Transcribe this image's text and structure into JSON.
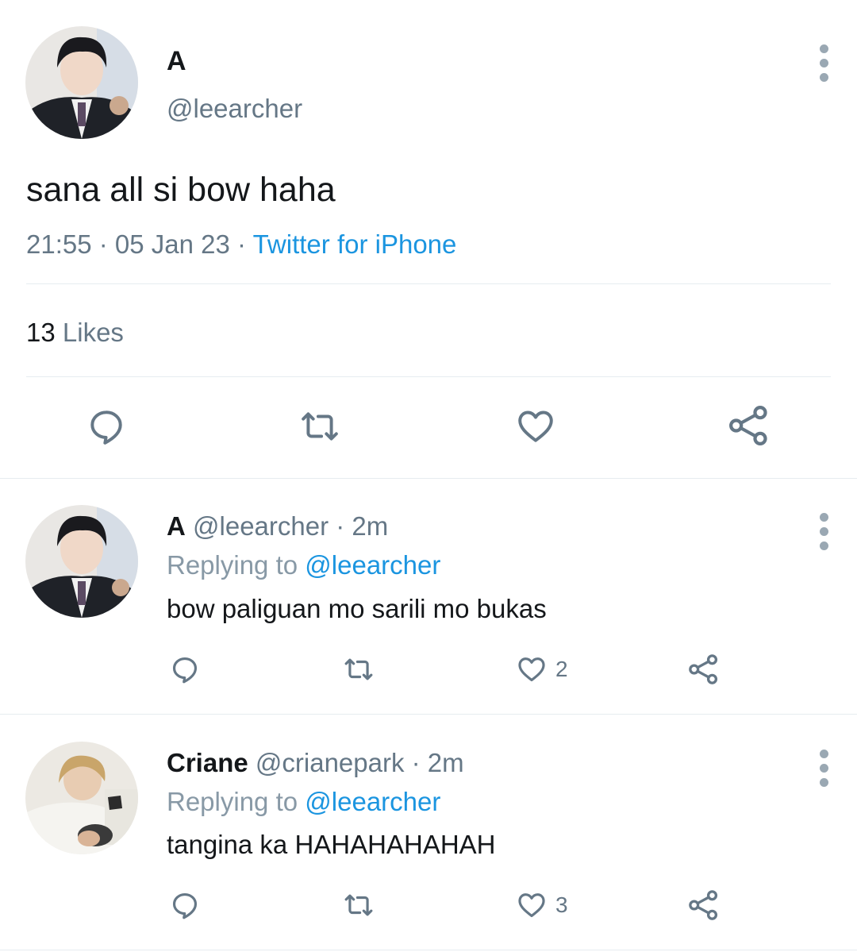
{
  "tweet": {
    "name": "A",
    "handle": "@leearcher",
    "text": "sana all si bow haha",
    "time": "21:55 · 05 Jan 23 · ",
    "source": "Twitter for iPhone",
    "likes_count": "13",
    "likes_label": "Likes"
  },
  "icons": {
    "reply": "reply-icon",
    "retweet": "retweet-icon",
    "like": "heart-icon",
    "share": "share-icon",
    "more": "more-vertical-icon"
  },
  "replies": [
    {
      "name": "A",
      "handle": "@leearcher",
      "time": "2m",
      "replying_label": "Replying to",
      "replying_to": "@leearcher",
      "text": "bow paliguan mo sarili mo bukas",
      "like_count": "2"
    },
    {
      "name": "Criane",
      "handle": "@crianepark",
      "time": "2m",
      "replying_label": "Replying to",
      "replying_to": "@leearcher",
      "text": "tangina ka HAHAHAHAHAH",
      "like_count": "3"
    }
  ],
  "colors": {
    "accent": "#1b95e0",
    "secondary_text": "#657786",
    "divider": "#e6ecf0"
  }
}
